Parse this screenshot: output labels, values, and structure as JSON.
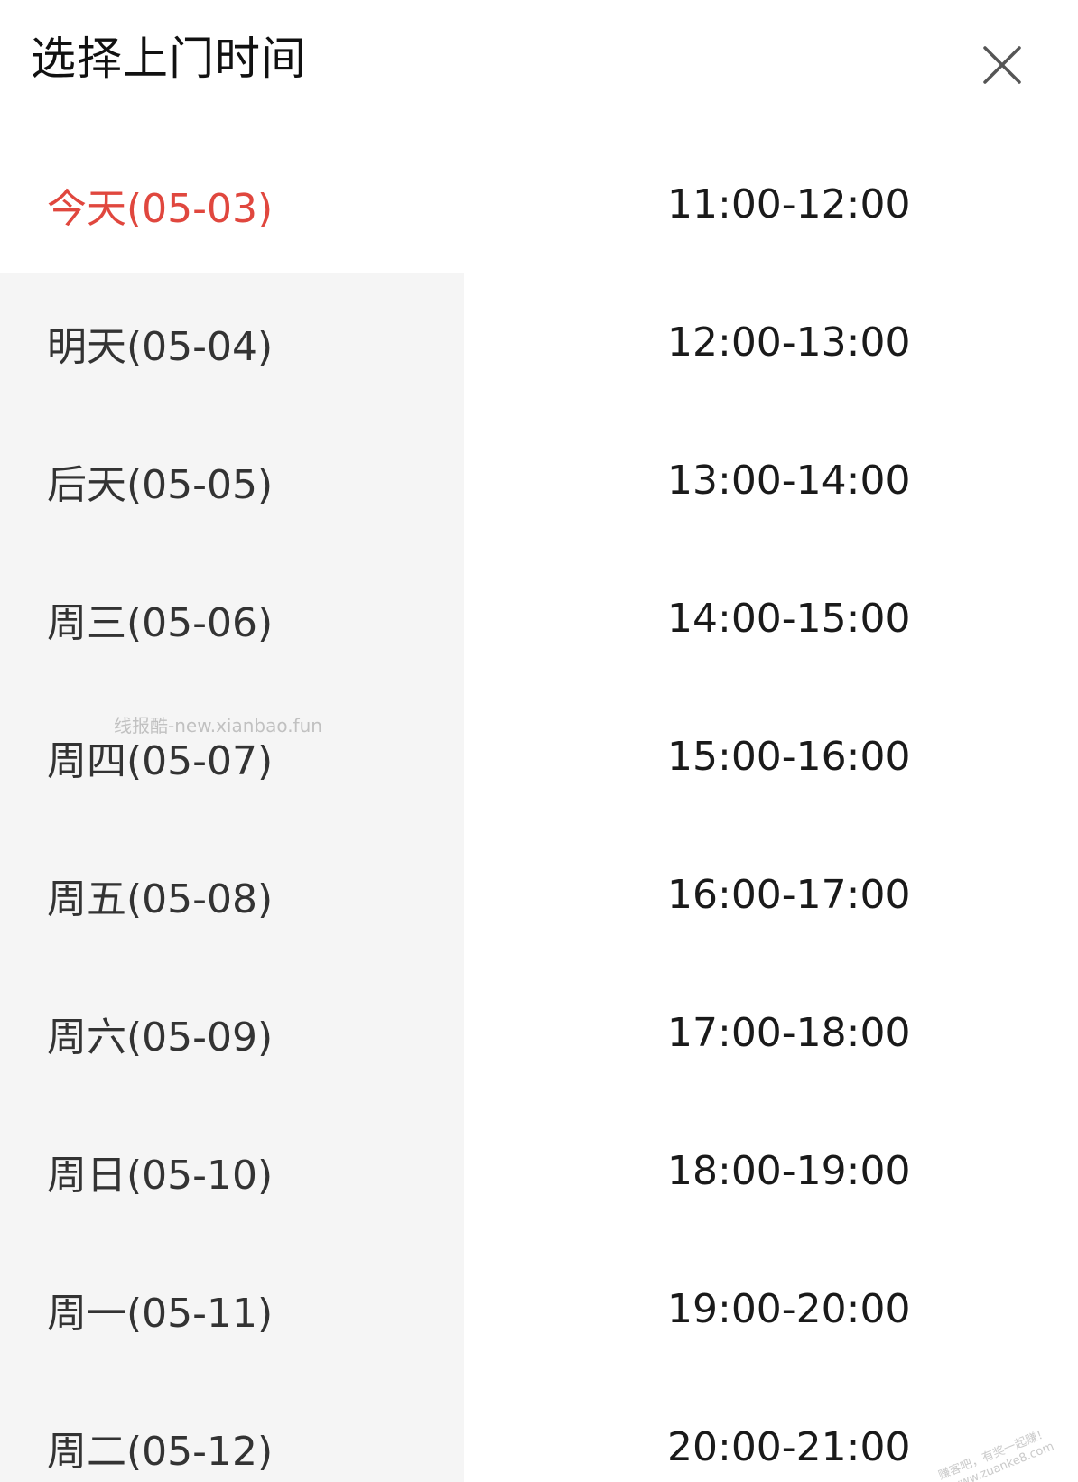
{
  "header": {
    "title": "选择上门时间",
    "close_icon": "close-icon"
  },
  "colors": {
    "selected": "#e0473e",
    "date_panel_bg": "#f5f5f5"
  },
  "dates": [
    {
      "label": "今天(05-03)",
      "selected": true
    },
    {
      "label": "明天(05-04)",
      "selected": false
    },
    {
      "label": "后天(05-05)",
      "selected": false
    },
    {
      "label": "周三(05-06)",
      "selected": false
    },
    {
      "label": "周四(05-07)",
      "selected": false
    },
    {
      "label": "周五(05-08)",
      "selected": false
    },
    {
      "label": "周六(05-09)",
      "selected": false
    },
    {
      "label": "周日(05-10)",
      "selected": false
    },
    {
      "label": "周一(05-11)",
      "selected": false
    },
    {
      "label": "周二(05-12)",
      "selected": false
    }
  ],
  "times": [
    {
      "label": "11:00-12:00"
    },
    {
      "label": "12:00-13:00"
    },
    {
      "label": "13:00-14:00"
    },
    {
      "label": "14:00-15:00"
    },
    {
      "label": "15:00-16:00"
    },
    {
      "label": "16:00-17:00"
    },
    {
      "label": "17:00-18:00"
    },
    {
      "label": "18:00-19:00"
    },
    {
      "label": "19:00-20:00"
    },
    {
      "label": "20:00-21:00"
    }
  ],
  "watermark": "线报酷-new.xianbao.fun",
  "corner_watermark": {
    "line1": "赚客吧，有奖一起赚！",
    "line2": "www.zuanke8.com"
  }
}
